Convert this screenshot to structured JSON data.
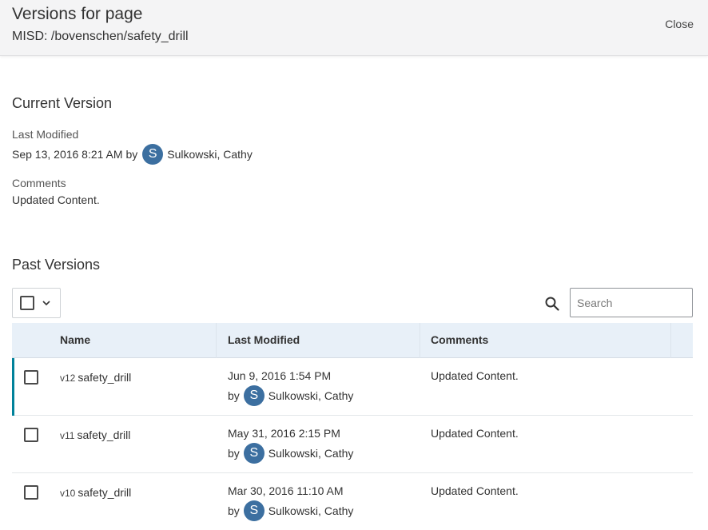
{
  "header": {
    "title": "Versions for page",
    "subtitle": "MISD: /bovenschen/safety_drill",
    "close_label": "Close"
  },
  "current_version": {
    "heading": "Current Version",
    "last_modified_label": "Last Modified",
    "last_modified_value": "Sep 13, 2016 8:21 AM by",
    "user_initial": "S",
    "user_name": "Sulkowski, Cathy",
    "comments_label": "Comments",
    "comments_value": "Updated Content."
  },
  "past_versions": {
    "heading": "Past Versions",
    "search_placeholder": "Search",
    "columns": [
      "Name",
      "Last Modified",
      "Comments"
    ],
    "rows": [
      {
        "version": "v12",
        "name": "safety_drill",
        "date": "Jun 9, 2016 1:54 PM",
        "by": "by",
        "user_initial": "S",
        "user_name": "Sulkowski, Cathy",
        "comment": "Updated Content."
      },
      {
        "version": "v11",
        "name": "safety_drill",
        "date": "May 31, 2016 2:15 PM",
        "by": "by",
        "user_initial": "S",
        "user_name": "Sulkowski, Cathy",
        "comment": "Updated Content."
      },
      {
        "version": "v10",
        "name": "safety_drill",
        "date": "Mar 30, 2016 11:10 AM",
        "by": "by",
        "user_initial": "S",
        "user_name": "Sulkowski, Cathy",
        "comment": "Updated Content."
      }
    ]
  },
  "colors": {
    "accent": "#00829b",
    "avatar": "#3c6fa0",
    "table_header": "#e8f0f8"
  }
}
